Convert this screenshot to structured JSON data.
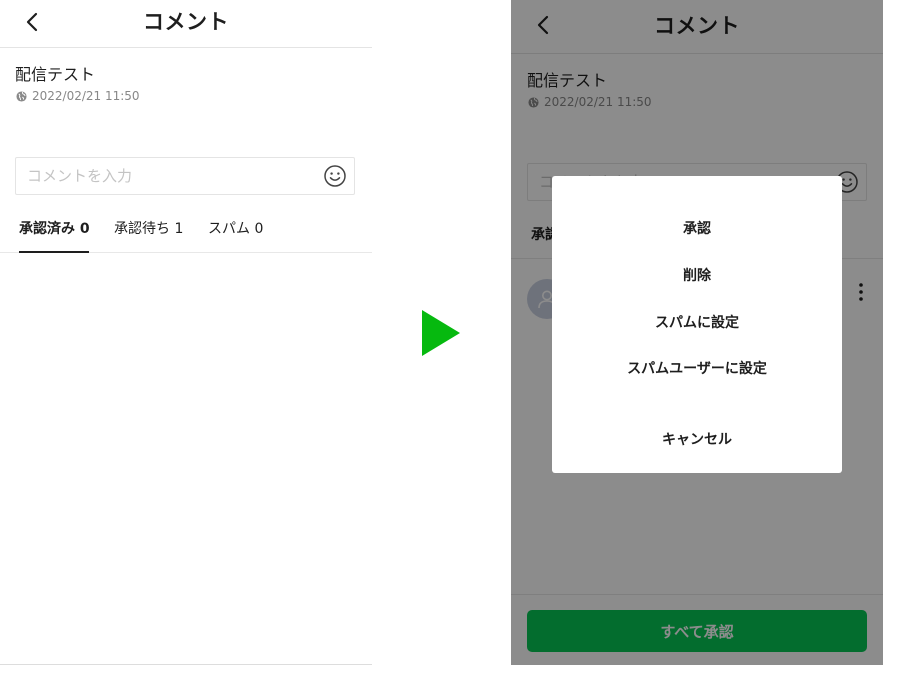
{
  "left_screen": {
    "header": {
      "title": "コメント"
    },
    "post": {
      "title": "配信テスト",
      "timestamp": "2022/02/21 11:50"
    },
    "comment_input": {
      "placeholder": "コメントを入力",
      "value": ""
    },
    "tabs": [
      {
        "label": "承認済み 0",
        "active": true
      },
      {
        "label": "承認待ち 1",
        "active": false
      },
      {
        "label": "スパム 0",
        "active": false
      }
    ]
  },
  "right_screen": {
    "header": {
      "title": "コメント"
    },
    "post": {
      "title": "配信テスト",
      "timestamp": "2022/02/21 11:50"
    },
    "comment_input": {
      "placeholder": "コメントを入力",
      "value": ""
    },
    "tabs_visible_fragment": "承認",
    "approve_all_label": "すべて承認",
    "dialog": {
      "items": [
        "承認",
        "削除",
        "スパムに設定",
        "スパムユーザーに設定"
      ],
      "cancel_label": "キャンセル"
    }
  },
  "colors": {
    "brand_green": "#06c755",
    "arrow_green": "#06b90f",
    "text_primary": "#1e1e1e",
    "text_meta": "#888888",
    "placeholder": "#c4c4c4"
  },
  "icons": [
    "back-arrow-icon",
    "globe-icon",
    "emoji-icon",
    "user-avatar-icon",
    "more-vertical-icon",
    "play-arrow-icon"
  ]
}
